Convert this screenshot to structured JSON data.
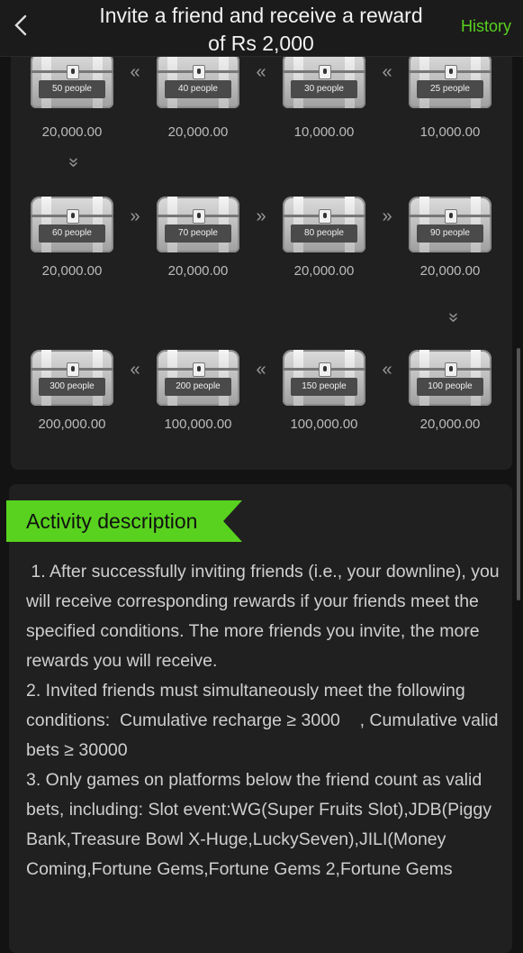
{
  "header": {
    "title": "Invite a friend and receive a reward of Rs 2,000",
    "history_label": "History"
  },
  "colors": {
    "accent": "#58d21f"
  },
  "icons": {
    "back": "chevron-left-icon",
    "chest": "treasure-chest-icon"
  },
  "reward_rows": [
    {
      "chests": [
        {
          "label": "50 people",
          "amount": "20,000.00"
        },
        {
          "label": "40 people",
          "amount": "20,000.00"
        },
        {
          "label": "30 people",
          "amount": "10,000.00"
        },
        {
          "label": "25 people",
          "amount": "10,000.00"
        }
      ],
      "arrow": "«"
    },
    {
      "chests": [
        {
          "label": "60 people",
          "amount": "20,000.00"
        },
        {
          "label": "70 people",
          "amount": "20,000.00"
        },
        {
          "label": "80 people",
          "amount": "20,000.00"
        },
        {
          "label": "90 people",
          "amount": "20,000.00"
        }
      ],
      "arrow": "»"
    },
    {
      "chests": [
        {
          "label": "300 people",
          "amount": "200,000.00"
        },
        {
          "label": "200 people",
          "amount": "100,000.00"
        },
        {
          "label": "150 people",
          "amount": "100,000.00"
        },
        {
          "label": "100 people",
          "amount": "20,000.00"
        }
      ],
      "arrow": "«"
    }
  ],
  "down_arrow": "»",
  "description": {
    "tag": "Activity description",
    "text": " 1. After successfully inviting friends (i.e., your downline), you will receive corresponding rewards if your friends meet the specified conditions. The more friends you invite, the more rewards you will receive.\n2. Invited friends must simultaneously meet the following conditions:  Cumulative recharge ≥ 3000    , Cumulative valid bets ≥ 30000\n3. Only games on platforms below the friend count as valid bets, including: Slot event:WG(Super Fruits Slot),JDB(Piggy Bank,Treasure Bowl X-Huge,LuckySeven),JILI(Money Coming,Fortune Gems,Fortune Gems 2,Fortune Gems"
  }
}
